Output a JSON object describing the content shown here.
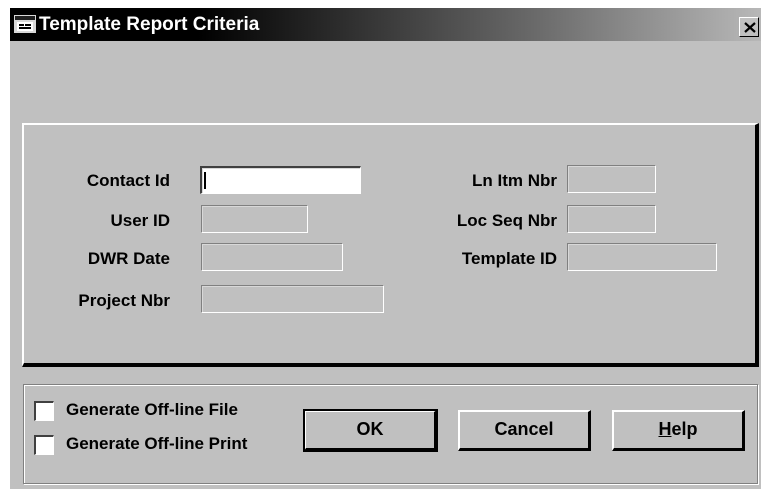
{
  "window": {
    "title": "Template Report Criteria",
    "close_glyph": "✕"
  },
  "fields": {
    "contact_id": {
      "label": "Contact Id",
      "value": ""
    },
    "user_id": {
      "label": "User ID",
      "value": ""
    },
    "dwr_date": {
      "label": "DWR Date",
      "value": ""
    },
    "project_nbr": {
      "label": "Project Nbr",
      "value": ""
    },
    "ln_itm_nbr": {
      "label": "Ln Itm Nbr",
      "value": ""
    },
    "loc_seq_nbr": {
      "label": "Loc Seq Nbr",
      "value": ""
    },
    "template_id": {
      "label": "Template ID",
      "value": ""
    }
  },
  "options": {
    "generate_file": {
      "label": "Generate Off-line File",
      "checked": false
    },
    "generate_print": {
      "label": "Generate Off-line Print",
      "checked": false
    }
  },
  "buttons": {
    "ok": "OK",
    "cancel": "Cancel",
    "help_mnemonic": "H",
    "help_rest": "elp"
  }
}
